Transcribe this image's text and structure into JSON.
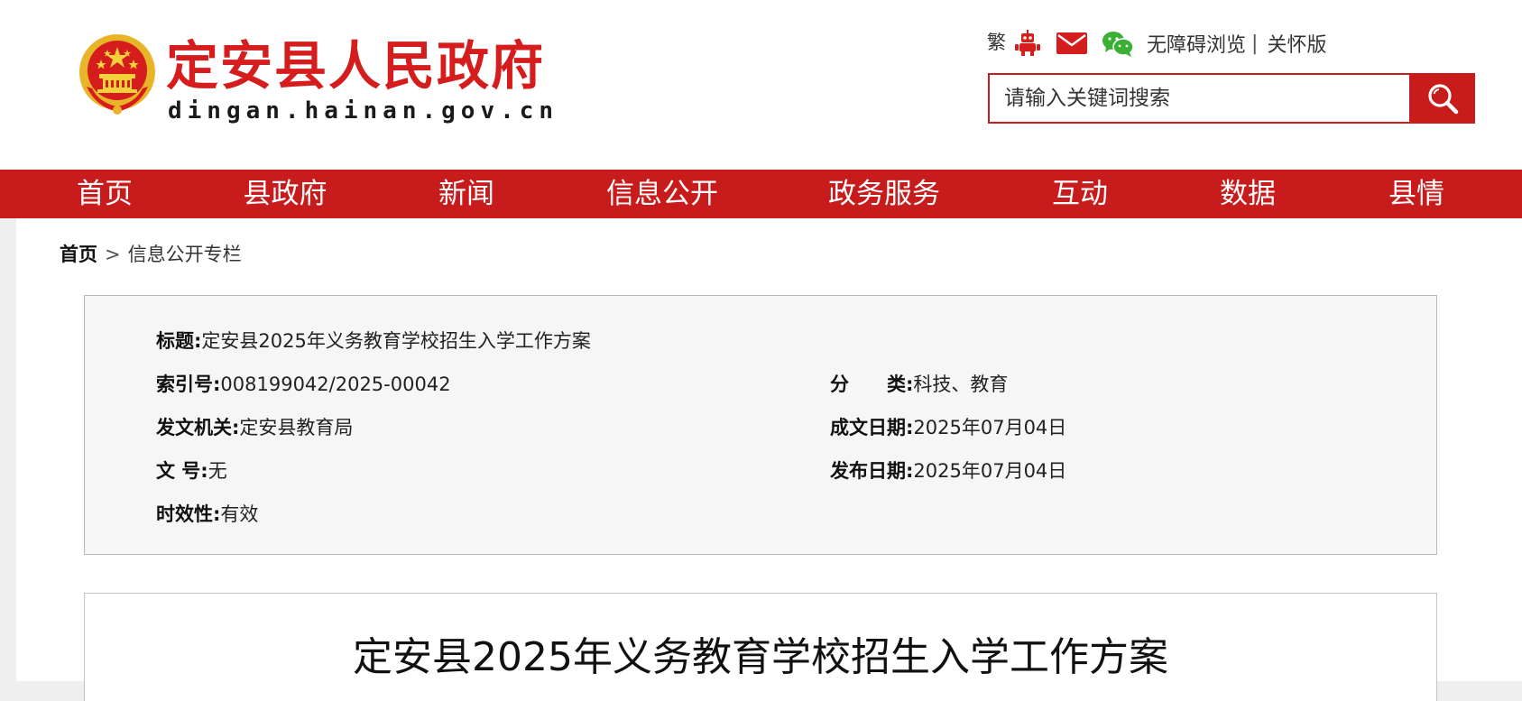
{
  "header": {
    "site_name": "定安县人民政府",
    "site_domain": "dingan.hainan.gov.cn",
    "toolbar": {
      "traditional_label": "繁",
      "accessibility_label": "无障碍浏览",
      "separator": "|",
      "care_mode_label": "关怀版"
    },
    "search": {
      "placeholder": "请输入关键词搜索"
    },
    "colors": {
      "brand_red": "#c81b1b",
      "logo_red": "#d51d1d",
      "wechat_green": "#3cb034"
    },
    "icons": [
      "robot-icon",
      "mail-icon",
      "wechat-icon",
      "search-icon",
      "national-emblem-icon"
    ]
  },
  "nav": {
    "items": [
      {
        "label": "首页"
      },
      {
        "label": "县政府"
      },
      {
        "label": "新闻"
      },
      {
        "label": "信息公开"
      },
      {
        "label": "政务服务"
      },
      {
        "label": "互动"
      },
      {
        "label": "数据"
      },
      {
        "label": "县情"
      }
    ]
  },
  "breadcrumb": {
    "home": "首页",
    "arrow": ">",
    "current": "信息公开专栏"
  },
  "meta": {
    "title_label": "标题:",
    "title_value": "定安县2025年义务教育学校招生入学工作方案",
    "index_label": "索引号:",
    "index_value": "008199042/2025-00042",
    "category_label": "分　　类:",
    "category_value": "科技、教育",
    "issuer_label": "发文机关:",
    "issuer_value": "定安县教育局",
    "written_date_label": "成文日期:",
    "written_date_value": "2025年07月04日",
    "doc_number_label": "文  号:",
    "doc_number_value": "无",
    "publish_date_label": "发布日期:",
    "publish_date_value": "2025年07月04日",
    "validity_label": "时效性:",
    "validity_value": "有效"
  },
  "article": {
    "title": "定安县2025年义务教育学校招生入学工作方案"
  }
}
